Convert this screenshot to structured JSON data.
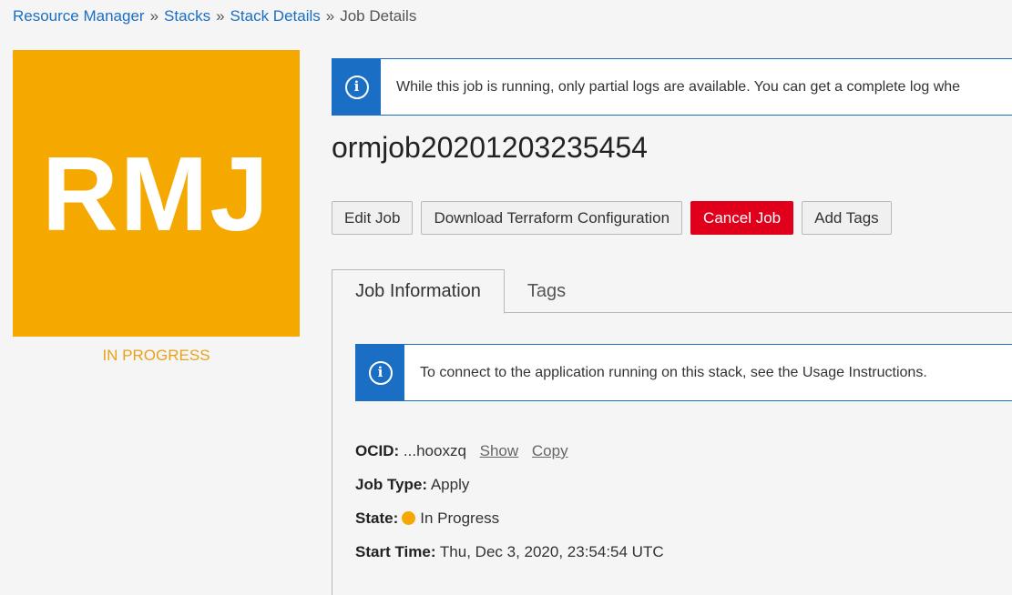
{
  "breadcrumb": {
    "items": [
      "Resource Manager",
      "Stacks",
      "Stack Details"
    ],
    "separator": "»",
    "current": "Job Details"
  },
  "badge": {
    "text": "RMJ",
    "status": "IN PROGRESS",
    "color": "#f5a800"
  },
  "alert_top": {
    "icon": "info-icon",
    "text": "While this job is running, only partial logs are available. You can get a complete log whe"
  },
  "job": {
    "title": "ormjob20201203235454"
  },
  "actions": {
    "edit": "Edit Job",
    "download": "Download Terraform Configuration",
    "cancel": "Cancel Job",
    "add_tags": "Add Tags"
  },
  "tabs": {
    "job_info": "Job Information",
    "tags": "Tags"
  },
  "alert_inner": {
    "icon": "info-icon",
    "text": "To connect to the application running on this stack, see the Usage Instructions."
  },
  "details": {
    "ocid_label": "OCID:",
    "ocid_value": "...hooxzq",
    "show_link": "Show",
    "copy_link": "Copy",
    "job_type_label": "Job Type:",
    "job_type_value": "Apply",
    "state_label": "State:",
    "state_value": "In Progress",
    "start_time_label": "Start Time:",
    "start_time_value": "Thu, Dec 3, 2020, 23:54:54 UTC"
  },
  "colors": {
    "accent_blue": "#1a6fc4",
    "danger_red": "#e0001b",
    "in_progress_orange": "#f5a800"
  }
}
